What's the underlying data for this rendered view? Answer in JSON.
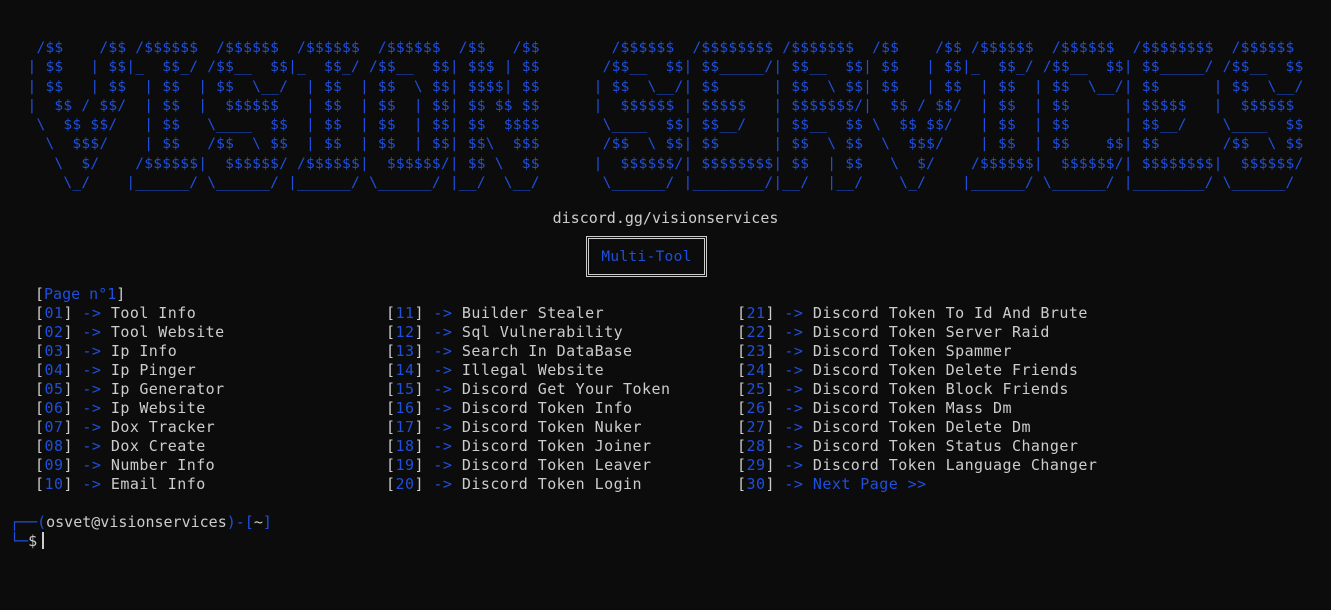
{
  "banner": {
    "art": " /$$    /$$ /$$$$$$  /$$$$$$  /$$$$$$  /$$$$$$  /$$   /$$        /$$$$$$  /$$$$$$$$ /$$$$$$$  /$$    /$$ /$$$$$$  /$$$$$$  /$$$$$$$$  /$$$$$$ \n| $$   | $$|_  $$_/ /$$__  $$|_  $$_/ /$$__  $$| $$$ | $$       /$$__  $$| $$_____/| $$__  $$| $$   | $$|_  $$_/ /$$__  $$| $$_____/ /$$__  $$\n| $$   | $$  | $$  | $$  \\__/  | $$  | $$  \\ $$| $$$$| $$      | $$  \\__/| $$      | $$  \\ $$| $$   | $$  | $$  | $$  \\__/| $$      | $$  \\__/\n|  $$ / $$/  | $$  |  $$$$$$   | $$  | $$  | $$| $$ $$ $$      |  $$$$$$ | $$$$$   | $$$$$$$/|  $$ / $$/  | $$  | $$      | $$$$$   |  $$$$$$ \n \\  $$ $$/   | $$   \\____  $$  | $$  | $$  | $$| $$  $$$$       \\____  $$| $$__/   | $$__  $$ \\  $$ $$/   | $$  | $$      | $$__/    \\____  $$\n  \\  $$$/    | $$   /$$  \\ $$  | $$  | $$  | $$| $$\\  $$$       /$$  \\ $$| $$      | $$  \\ $$  \\  $$$/    | $$  | $$    $$| $$       /$$  \\ $$\n   \\  $/    /$$$$$$|  $$$$$$/ /$$$$$$|  $$$$$$/| $$ \\  $$      |  $$$$$$/| $$$$$$$$| $$  | $$   \\  $/    /$$$$$$|  $$$$$$/| $$$$$$$$|  $$$$$$/\n    \\_/    |______/ \\______/ |______/ \\______/ |__/  \\__/       \\______/ |________/|__/  |__/    \\_/    |______/ \\______/ |________/ \\______/ "
  },
  "subtitle": "discord.gg/visionservices",
  "title_box": "Multi-Tool",
  "page_label": {
    "open": "[",
    "text": "Page n°1",
    "close": "]"
  },
  "arrow": "->",
  "menu": {
    "col1": [
      {
        "num": "01",
        "label": "Tool Info"
      },
      {
        "num": "02",
        "label": "Tool Website"
      },
      {
        "num": "03",
        "label": "Ip Info"
      },
      {
        "num": "04",
        "label": "Ip Pinger"
      },
      {
        "num": "05",
        "label": "Ip Generator"
      },
      {
        "num": "06",
        "label": "Ip Website"
      },
      {
        "num": "07",
        "label": "Dox Tracker"
      },
      {
        "num": "08",
        "label": "Dox Create"
      },
      {
        "num": "09",
        "label": "Number Info"
      },
      {
        "num": "10",
        "label": "Email Info"
      }
    ],
    "col2": [
      {
        "num": "11",
        "label": "Builder Stealer"
      },
      {
        "num": "12",
        "label": "Sql Vulnerability"
      },
      {
        "num": "13",
        "label": "Search In DataBase"
      },
      {
        "num": "14",
        "label": "Illegal Website"
      },
      {
        "num": "15",
        "label": "Discord Get Your Token"
      },
      {
        "num": "16",
        "label": "Discord Token Info"
      },
      {
        "num": "17",
        "label": "Discord Token Nuker"
      },
      {
        "num": "18",
        "label": "Discord Token Joiner"
      },
      {
        "num": "19",
        "label": "Discord Token Leaver"
      },
      {
        "num": "20",
        "label": "Discord Token Login"
      }
    ],
    "col3": [
      {
        "num": "21",
        "label": "Discord Token To Id And Brute"
      },
      {
        "num": "22",
        "label": "Discord Token Server Raid"
      },
      {
        "num": "23",
        "label": "Discord Token Spammer"
      },
      {
        "num": "24",
        "label": "Discord Token Delete Friends"
      },
      {
        "num": "25",
        "label": "Discord Token Block Friends"
      },
      {
        "num": "26",
        "label": "Discord Token Mass Dm"
      },
      {
        "num": "27",
        "label": "Discord Token Delete Dm"
      },
      {
        "num": "28",
        "label": "Discord Token Status Changer"
      },
      {
        "num": "29",
        "label": "Discord Token Language Changer"
      },
      {
        "num": "30",
        "label": "Next Page >>"
      }
    ]
  },
  "prompt": {
    "corner_top": "┌──",
    "user_host": "osvet@visionservices",
    "sep": ")-[",
    "cwd": "~",
    "close": "]",
    "corner_bottom": "└─",
    "symbol": "$"
  },
  "colors": {
    "background": "#0c0c0c",
    "accent_blue": "#1f4fdc",
    "text": "#cccccc"
  }
}
